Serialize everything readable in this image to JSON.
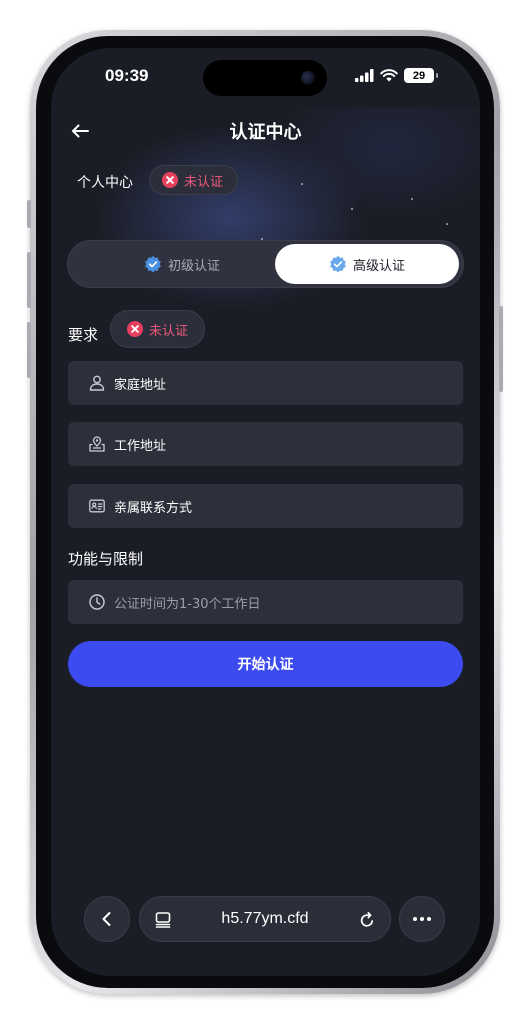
{
  "status": {
    "time": "09:39",
    "battery": "29"
  },
  "header": {
    "title": "认证中心"
  },
  "personal": {
    "label": "个人中心",
    "status": "未认证"
  },
  "tabs": [
    {
      "label": "初级认证",
      "active": false
    },
    {
      "label": "高级认证",
      "active": true
    }
  ],
  "requirements": {
    "label": "要求",
    "status": "未认证",
    "items": [
      {
        "label": "家庭地址",
        "icon": "user-icon"
      },
      {
        "label": "工作地址",
        "icon": "location-icon"
      },
      {
        "label": "亲属联系方式",
        "icon": "contact-card-icon"
      }
    ]
  },
  "features": {
    "label": "功能与限制",
    "note": "公证时间为1-30个工作日",
    "icon": "clock-icon"
  },
  "action": {
    "start_label": "开始认证"
  },
  "browser": {
    "url": "h5.77ym.cfd"
  },
  "colors": {
    "accent": "#3b4bf0",
    "danger": "#e7405f",
    "background": "#1b1d26",
    "verify_badge": "#4a90e2"
  }
}
